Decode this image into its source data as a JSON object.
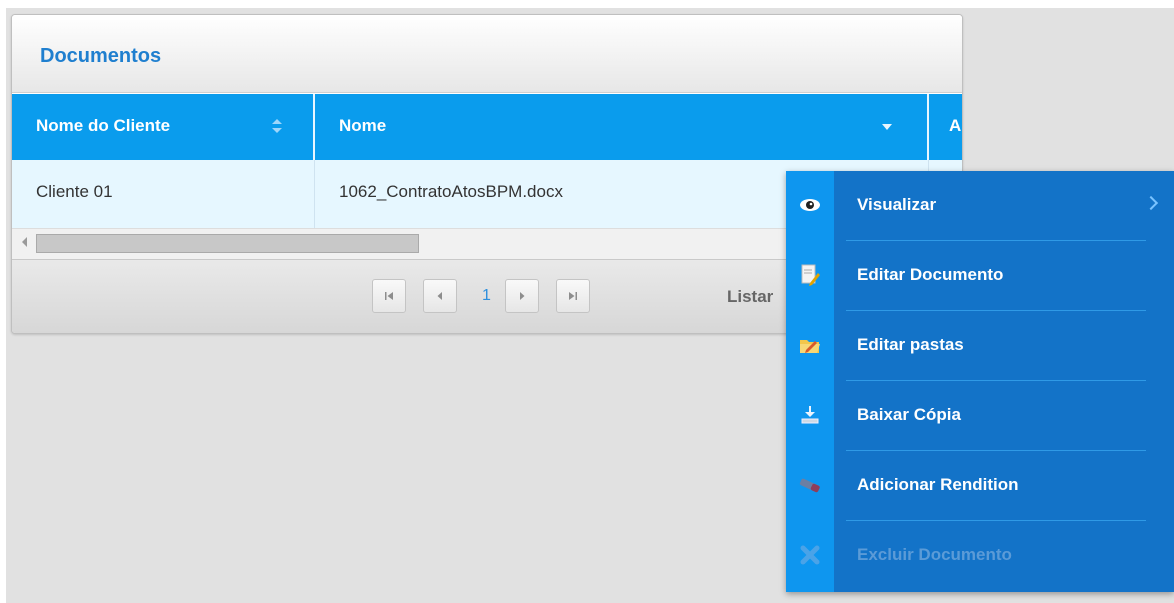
{
  "panel": {
    "title": "Documentos"
  },
  "grid": {
    "columns": [
      "Nome do Cliente",
      "Nome",
      "A"
    ],
    "rows": [
      {
        "cliente": "Cliente 01",
        "nome": "1062_ContratoAtosBPM.docx"
      }
    ]
  },
  "pager": {
    "first_label": "⏮",
    "prev_label": "◀",
    "page": "1",
    "next_label": "▶",
    "last_label": "⏭",
    "listing_text": "Listar"
  },
  "context_menu": {
    "items": [
      {
        "label": "Visualizar",
        "icon": "eye-icon",
        "enabled": true,
        "submenu": true
      },
      {
        "label": "Editar Documento",
        "icon": "edit-document-icon",
        "enabled": true
      },
      {
        "label": "Editar pastas",
        "icon": "folder-edit-icon",
        "enabled": true
      },
      {
        "label": "Baixar Cópia",
        "icon": "download-icon",
        "enabled": true
      },
      {
        "label": "Adicionar Rendition",
        "icon": "rendition-icon",
        "enabled": true
      },
      {
        "label": "Excluir Documento",
        "icon": "delete-icon",
        "enabled": false
      }
    ]
  },
  "colors": {
    "header_blue": "#0a9ced",
    "title_blue": "#1f7fcf",
    "menu_blue": "#1373c8",
    "menu_strip": "#0e96ef",
    "row_highlight": "#e6f7ff"
  }
}
